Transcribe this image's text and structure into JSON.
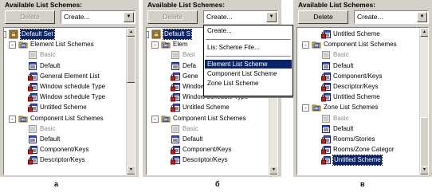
{
  "panels": [
    {
      "title": "Available List Schemes:",
      "delete_label": "Delete",
      "delete_disabled": true,
      "create_value": "Create...",
      "caption": "а",
      "rows": [
        {
          "label": "Default Set",
          "icon": "set",
          "level": 0,
          "pm": "-",
          "selected": true
        },
        {
          "label": "Element List Schemes",
          "icon": "folder-book",
          "level": 1,
          "pm": "-"
        },
        {
          "label": "Basic",
          "icon": "scheme-grey",
          "level": 2,
          "grey": true
        },
        {
          "label": "Default",
          "icon": "scheme",
          "level": 2
        },
        {
          "label": "General Element List",
          "icon": "scheme-lock",
          "level": 2
        },
        {
          "label": "Window schedule Type",
          "icon": "scheme-lock",
          "level": 2
        },
        {
          "label": "Window schedule Type",
          "icon": "scheme-lock",
          "level": 2
        },
        {
          "label": "Untitled Scheme",
          "icon": "scheme-lock",
          "level": 2
        },
        {
          "label": "Component List Schemes",
          "icon": "folder-book",
          "level": 1,
          "pm": "-"
        },
        {
          "label": "Basic",
          "icon": "scheme-grey",
          "level": 2,
          "grey": true
        },
        {
          "label": "Default",
          "icon": "scheme",
          "level": 2
        },
        {
          "label": "Component/Keys",
          "icon": "scheme-lock",
          "level": 2
        },
        {
          "label": "Descriptor/Keys",
          "icon": "scheme-lock",
          "level": 2
        }
      ]
    },
    {
      "title": "Available List Schemes:",
      "delete_label": "Delete",
      "delete_disabled": true,
      "create_value": "Create...",
      "caption": "б",
      "rows": [
        {
          "label": "Default S",
          "icon": "set",
          "level": 0,
          "pm": "-",
          "selected": true
        },
        {
          "label": "Elem",
          "icon": "folder-book",
          "level": 1,
          "pm": "-"
        },
        {
          "label": "Basi",
          "icon": "scheme-grey",
          "level": 2,
          "grey": true
        },
        {
          "label": "Defa",
          "icon": "scheme",
          "level": 2
        },
        {
          "label": "Gene",
          "icon": "scheme-lock",
          "level": 2
        },
        {
          "label": "Window schedule Typ",
          "icon": "scheme-lock",
          "level": 2
        },
        {
          "label": "Window schedule Type",
          "icon": "scheme-lock",
          "level": 2
        },
        {
          "label": "Untitled Scheme",
          "icon": "scheme-lock",
          "level": 2
        },
        {
          "label": "Component List Schemes",
          "icon": "folder-book",
          "level": 1,
          "pm": "-"
        },
        {
          "label": "Basic",
          "icon": "scheme-grey",
          "level": 2,
          "grey": true
        },
        {
          "label": "Default",
          "icon": "scheme",
          "level": 2
        },
        {
          "label": "Component/Keys",
          "icon": "scheme-lock",
          "level": 2
        },
        {
          "label": "Descriptor/Keys",
          "icon": "scheme-lock",
          "level": 2
        }
      ],
      "menu": {
        "items": [
          {
            "label": "Create...",
            "type": "item"
          },
          {
            "type": "sep"
          },
          {
            "label": "Lis: Scheme File...",
            "type": "item"
          },
          {
            "type": "sep"
          },
          {
            "label": "Element List Scheme",
            "type": "item",
            "highlighted": true
          },
          {
            "label": "Component List Scheme",
            "type": "item"
          },
          {
            "label": "Zone List Scheme",
            "type": "item"
          }
        ]
      }
    },
    {
      "title": "Available List Schemes:",
      "delete_label": "Delete",
      "delete_disabled": false,
      "create_value": "Create...",
      "caption": "в",
      "rows": [
        {
          "label": "Untitled Scheme",
          "icon": "scheme-lock",
          "level": 2
        },
        {
          "label": "Component List Schemes",
          "icon": "folder-book",
          "level": 1,
          "pm": "-"
        },
        {
          "label": "Basic",
          "icon": "scheme-grey",
          "level": 2,
          "grey": true
        },
        {
          "label": "Default",
          "icon": "scheme",
          "level": 2
        },
        {
          "label": "Component/Keys",
          "icon": "scheme-lock",
          "level": 2
        },
        {
          "label": "Descriptor/Keys",
          "icon": "scheme-lock",
          "level": 2
        },
        {
          "label": "Untitled Scheme",
          "icon": "scheme-lock",
          "level": 2
        },
        {
          "label": "Zone List Schemes",
          "icon": "folder-book",
          "level": 1,
          "pm": "-"
        },
        {
          "label": "Basic",
          "icon": "scheme-grey",
          "level": 2,
          "grey": true
        },
        {
          "label": "Default",
          "icon": "scheme",
          "level": 2
        },
        {
          "label": "Rooms/Stories",
          "icon": "scheme-lock",
          "level": 2
        },
        {
          "label": "Rooms/Zone Categor",
          "icon": "scheme-lock",
          "level": 2
        },
        {
          "label": "Untitled Scheme",
          "icon": "scheme-lock",
          "level": 2,
          "selected": true
        }
      ]
    }
  ],
  "icons": {
    "set": "book-set-icon",
    "folder-book": "open-book-folder-icon",
    "scheme": "list-scheme-icon",
    "scheme-grey": "basic-scheme-icon",
    "scheme-lock": "list-scheme-lock-icon"
  },
  "colors": {
    "selection": "#0a246a",
    "panel_bg": "#d4d0c8"
  }
}
